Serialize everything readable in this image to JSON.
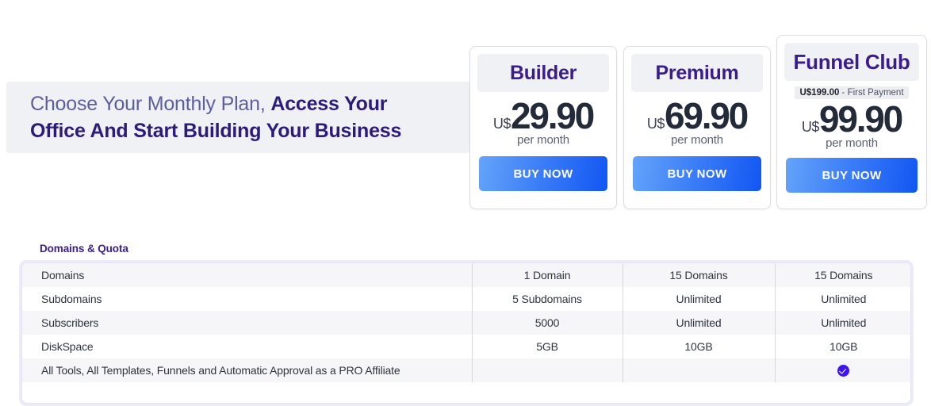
{
  "headline": {
    "lead": "Choose Your Monthly Plan, ",
    "emphasis_line1": "Access Your",
    "emphasis_line2": "Office And Start Building Your Business"
  },
  "plans": [
    {
      "name": "Builder",
      "currency": "U$",
      "amount": "29.90",
      "period": "per month",
      "badge": null,
      "badge_bold": null,
      "badge_rest": null,
      "cta": "BUY NOW"
    },
    {
      "name": "Premium",
      "currency": "U$",
      "amount": "69.90",
      "period": "per month",
      "badge": null,
      "badge_bold": null,
      "badge_rest": null,
      "cta": "BUY NOW"
    },
    {
      "name": "Funnel Club",
      "currency": "U$",
      "amount": "99.90",
      "period": "per month",
      "badge_bold": "U$199.00",
      "badge_rest": " - First Payment",
      "cta": "BUY NOW"
    }
  ],
  "features_section": {
    "title": "Domains & Quota",
    "rows": [
      {
        "label": "Domains",
        "builder": "1 Domain",
        "premium": "15 Domains",
        "club": "15 Domains"
      },
      {
        "label": "Subdomains",
        "builder": "5 Subdomains",
        "premium": "Unlimited",
        "club": "Unlimited"
      },
      {
        "label": "Subscribers",
        "builder": "5000",
        "premium": "Unlimited",
        "club": "Unlimited"
      },
      {
        "label": "DiskSpace",
        "builder": "5GB",
        "premium": "10GB",
        "club": "10GB"
      },
      {
        "label": "All Tools, All Templates, Funnels and Automatic Approval as a PRO Affiliate",
        "builder": "",
        "premium": "",
        "club": "check-icon"
      }
    ]
  },
  "colors": {
    "brand_purple": "#3b1c8c",
    "headline_muted": "#5c5f9c",
    "cta_gradient_start": "#64a4fa",
    "cta_gradient_end": "#1256f3",
    "check_badge": "#3d15f0",
    "panel_gray": "#f0f1f5",
    "table_wrap": "#ebebfa"
  }
}
